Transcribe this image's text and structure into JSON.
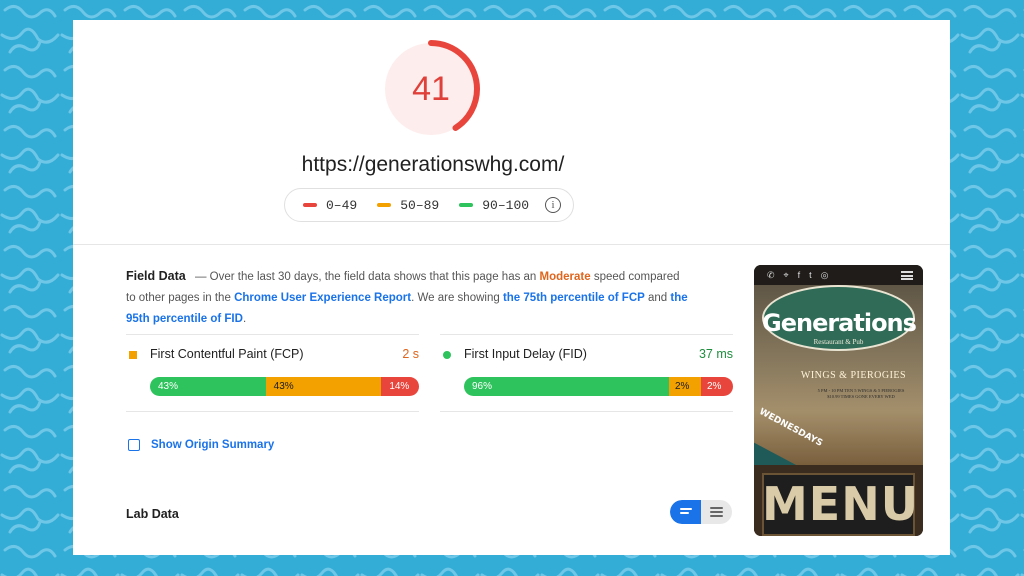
{
  "score": {
    "value": "41",
    "fraction": 0.41,
    "color": "#e0403a"
  },
  "url": "https://generationswhg.com/",
  "legend": {
    "items": [
      {
        "label": "0–49",
        "color": "#e8453c"
      },
      {
        "label": "50–89",
        "color": "#f2a100"
      },
      {
        "label": "90–100",
        "color": "#2ec35c"
      }
    ],
    "info_icon": "info-icon",
    "info_glyph": "i"
  },
  "field_data": {
    "title": "Field Data",
    "text_1": "— Over the last 30 days, the field data shows that this page has an ",
    "speed": "Moderate",
    "text_2": " speed compared to other pages in the ",
    "link_report": "Chrome User Experience Report",
    "text_3": ". We are showing ",
    "link_p75": "the 75th percentile of FCP",
    "text_4": " and ",
    "link_p95": "the 95th percentile of FID",
    "text_5": "."
  },
  "metrics": [
    {
      "label": "First Contentful Paint (FCP)",
      "value": "2 s",
      "value_color": "#e0651c",
      "marker": "square",
      "marker_color": "#f2a100",
      "segments": [
        {
          "pct": 43,
          "label": "43%",
          "color": "#2ec35c"
        },
        {
          "pct": 43,
          "label": "43%",
          "color": "#f2a100"
        },
        {
          "pct": 14,
          "label": "14%",
          "color": "#e8453c"
        }
      ]
    },
    {
      "label": "First Input Delay (FID)",
      "value": "37 ms",
      "value_color": "#1e8e3e",
      "marker": "circle",
      "marker_color": "#2ec35c",
      "segments": [
        {
          "pct": 96,
          "label": "96%",
          "color": "#2ec35c"
        },
        {
          "pct": 2,
          "label": "2%",
          "color": "#f2a100"
        },
        {
          "pct": 2,
          "label": "2%",
          "color": "#e8453c"
        }
      ]
    }
  ],
  "origin_summary": {
    "label": "Show Origin Summary",
    "checked": false
  },
  "lab_data": {
    "title": "Lab Data"
  },
  "view_toggle": {
    "left_icon": "list-view-icon",
    "right_icon": "detail-view-icon",
    "selected": "left"
  },
  "screenshot": {
    "icons": [
      "phone-icon",
      "location-icon",
      "facebook-icon",
      "twitter-icon",
      "instagram-icon"
    ],
    "icon_glyphs": [
      "✆",
      "⌖",
      "f",
      "t",
      "◎"
    ],
    "logo": "Generations",
    "logo_sub": "Restaurant & Pub",
    "headline": "WINGS & PIEROGIES",
    "small_text": "5 PM - 10 PM  TEN 5 WINGS & 5 PIEROGIES  $10.99  TIMES GONE EVERY WED",
    "day": "WEDNESDAYS",
    "sign": "MENU"
  }
}
